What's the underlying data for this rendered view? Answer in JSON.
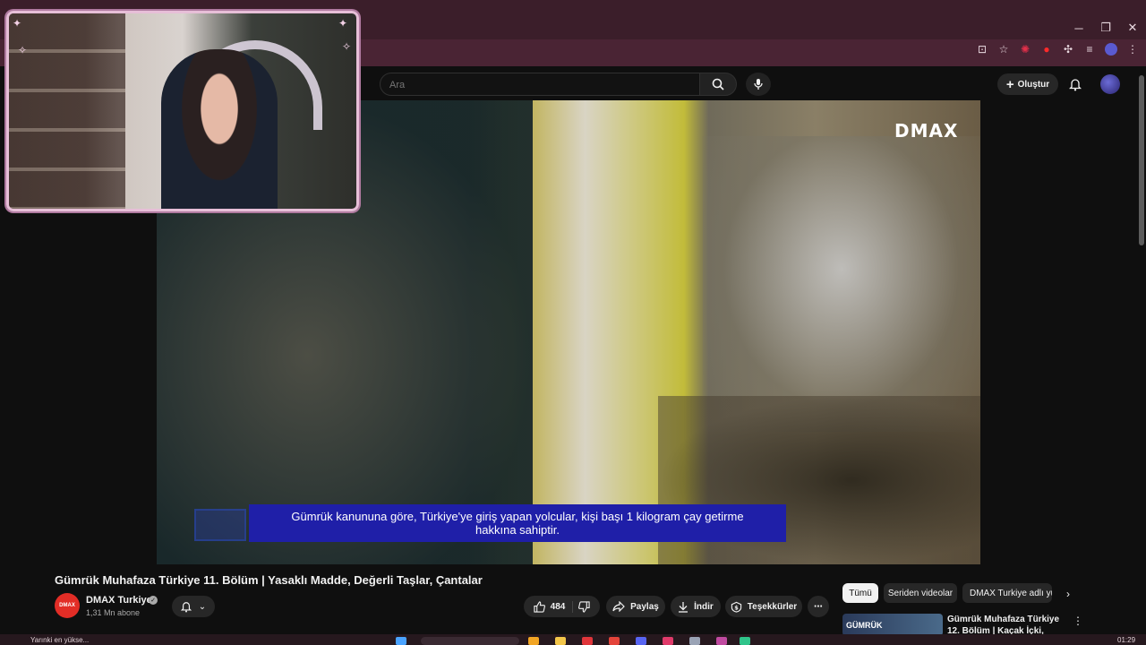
{
  "window": {
    "minimize": "─",
    "restore": "❐",
    "close": "✕"
  },
  "toolbar_icons": [
    "install-icon",
    "star-icon",
    "extension-red-icon",
    "extension-record-icon",
    "puzzle-icon",
    "tab-list-icon",
    "profile-icon",
    "kebab-icon"
  ],
  "header": {
    "search_placeholder": "Ara",
    "create_label": "Oluştur"
  },
  "video": {
    "logo": "DMAX",
    "subtitle_line1": "Gümrük kanununa göre, Türkiye'ye giriş yapan yolcular, kişi başı 1 kilogram çay getirme",
    "subtitle_line2": "hakkına sahiptir."
  },
  "meta": {
    "title": "Gümrük Muhafaza Türkiye 11. Bölüm | Yasaklı Madde, Değerli Taşlar, Çantalar",
    "channel_name": "DMAX Turkiye",
    "channel_avatar_text": "DMAX",
    "subscribers": "1,31 Mn abone"
  },
  "actions": {
    "like_count": "484",
    "share": "Paylaş",
    "download": "İndir",
    "thanks": "Teşekkürler"
  },
  "chips": [
    "Tümü",
    "Seriden videolar",
    "DMAX Turkiye adlı yü"
  ],
  "recommendation": {
    "thumb_label": "GÜMRÜK",
    "title": "Gümrük Muhafaza Türkiye 12. Bölüm | Kaçak İçki, Timsah"
  },
  "taskbar": {
    "status": "Yarınki en yükse...",
    "clock": "01:29"
  },
  "colors": {
    "brand_red": "#e22d26",
    "subtitle_blue": "#1f1fa8",
    "chrome": "#3b1e2a"
  }
}
